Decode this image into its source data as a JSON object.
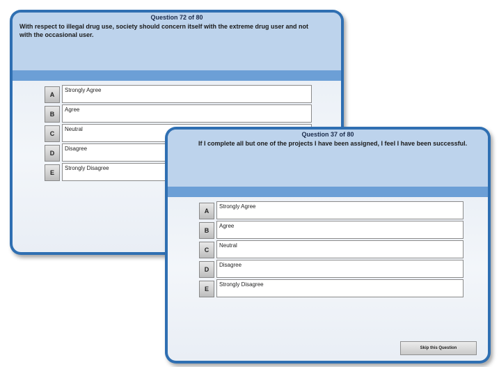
{
  "back_window": {
    "counter": "Question  72 of 80",
    "question": "With respect to illegal drug use, society should concern itself with the extreme drug user and not with the occasional user.",
    "options": [
      {
        "letter": "A",
        "label": "Strongly Agree"
      },
      {
        "letter": "B",
        "label": "Agree"
      },
      {
        "letter": "C",
        "label": "Neutral"
      },
      {
        "letter": "D",
        "label": "Disagree"
      },
      {
        "letter": "E",
        "label": "Strongly Disagree"
      }
    ]
  },
  "front_window": {
    "counter": "Question  37 of 80",
    "question": "If I complete all but one of the projects I have been assigned, I feel I have been successful.",
    "options": [
      {
        "letter": "A",
        "label": "Strongly Agree"
      },
      {
        "letter": "B",
        "label": "Agree"
      },
      {
        "letter": "C",
        "label": "Neutral"
      },
      {
        "letter": "D",
        "label": "Disagree"
      },
      {
        "letter": "E",
        "label": "Strongly Disagree"
      }
    ],
    "skip_label": "Skip this Question"
  }
}
